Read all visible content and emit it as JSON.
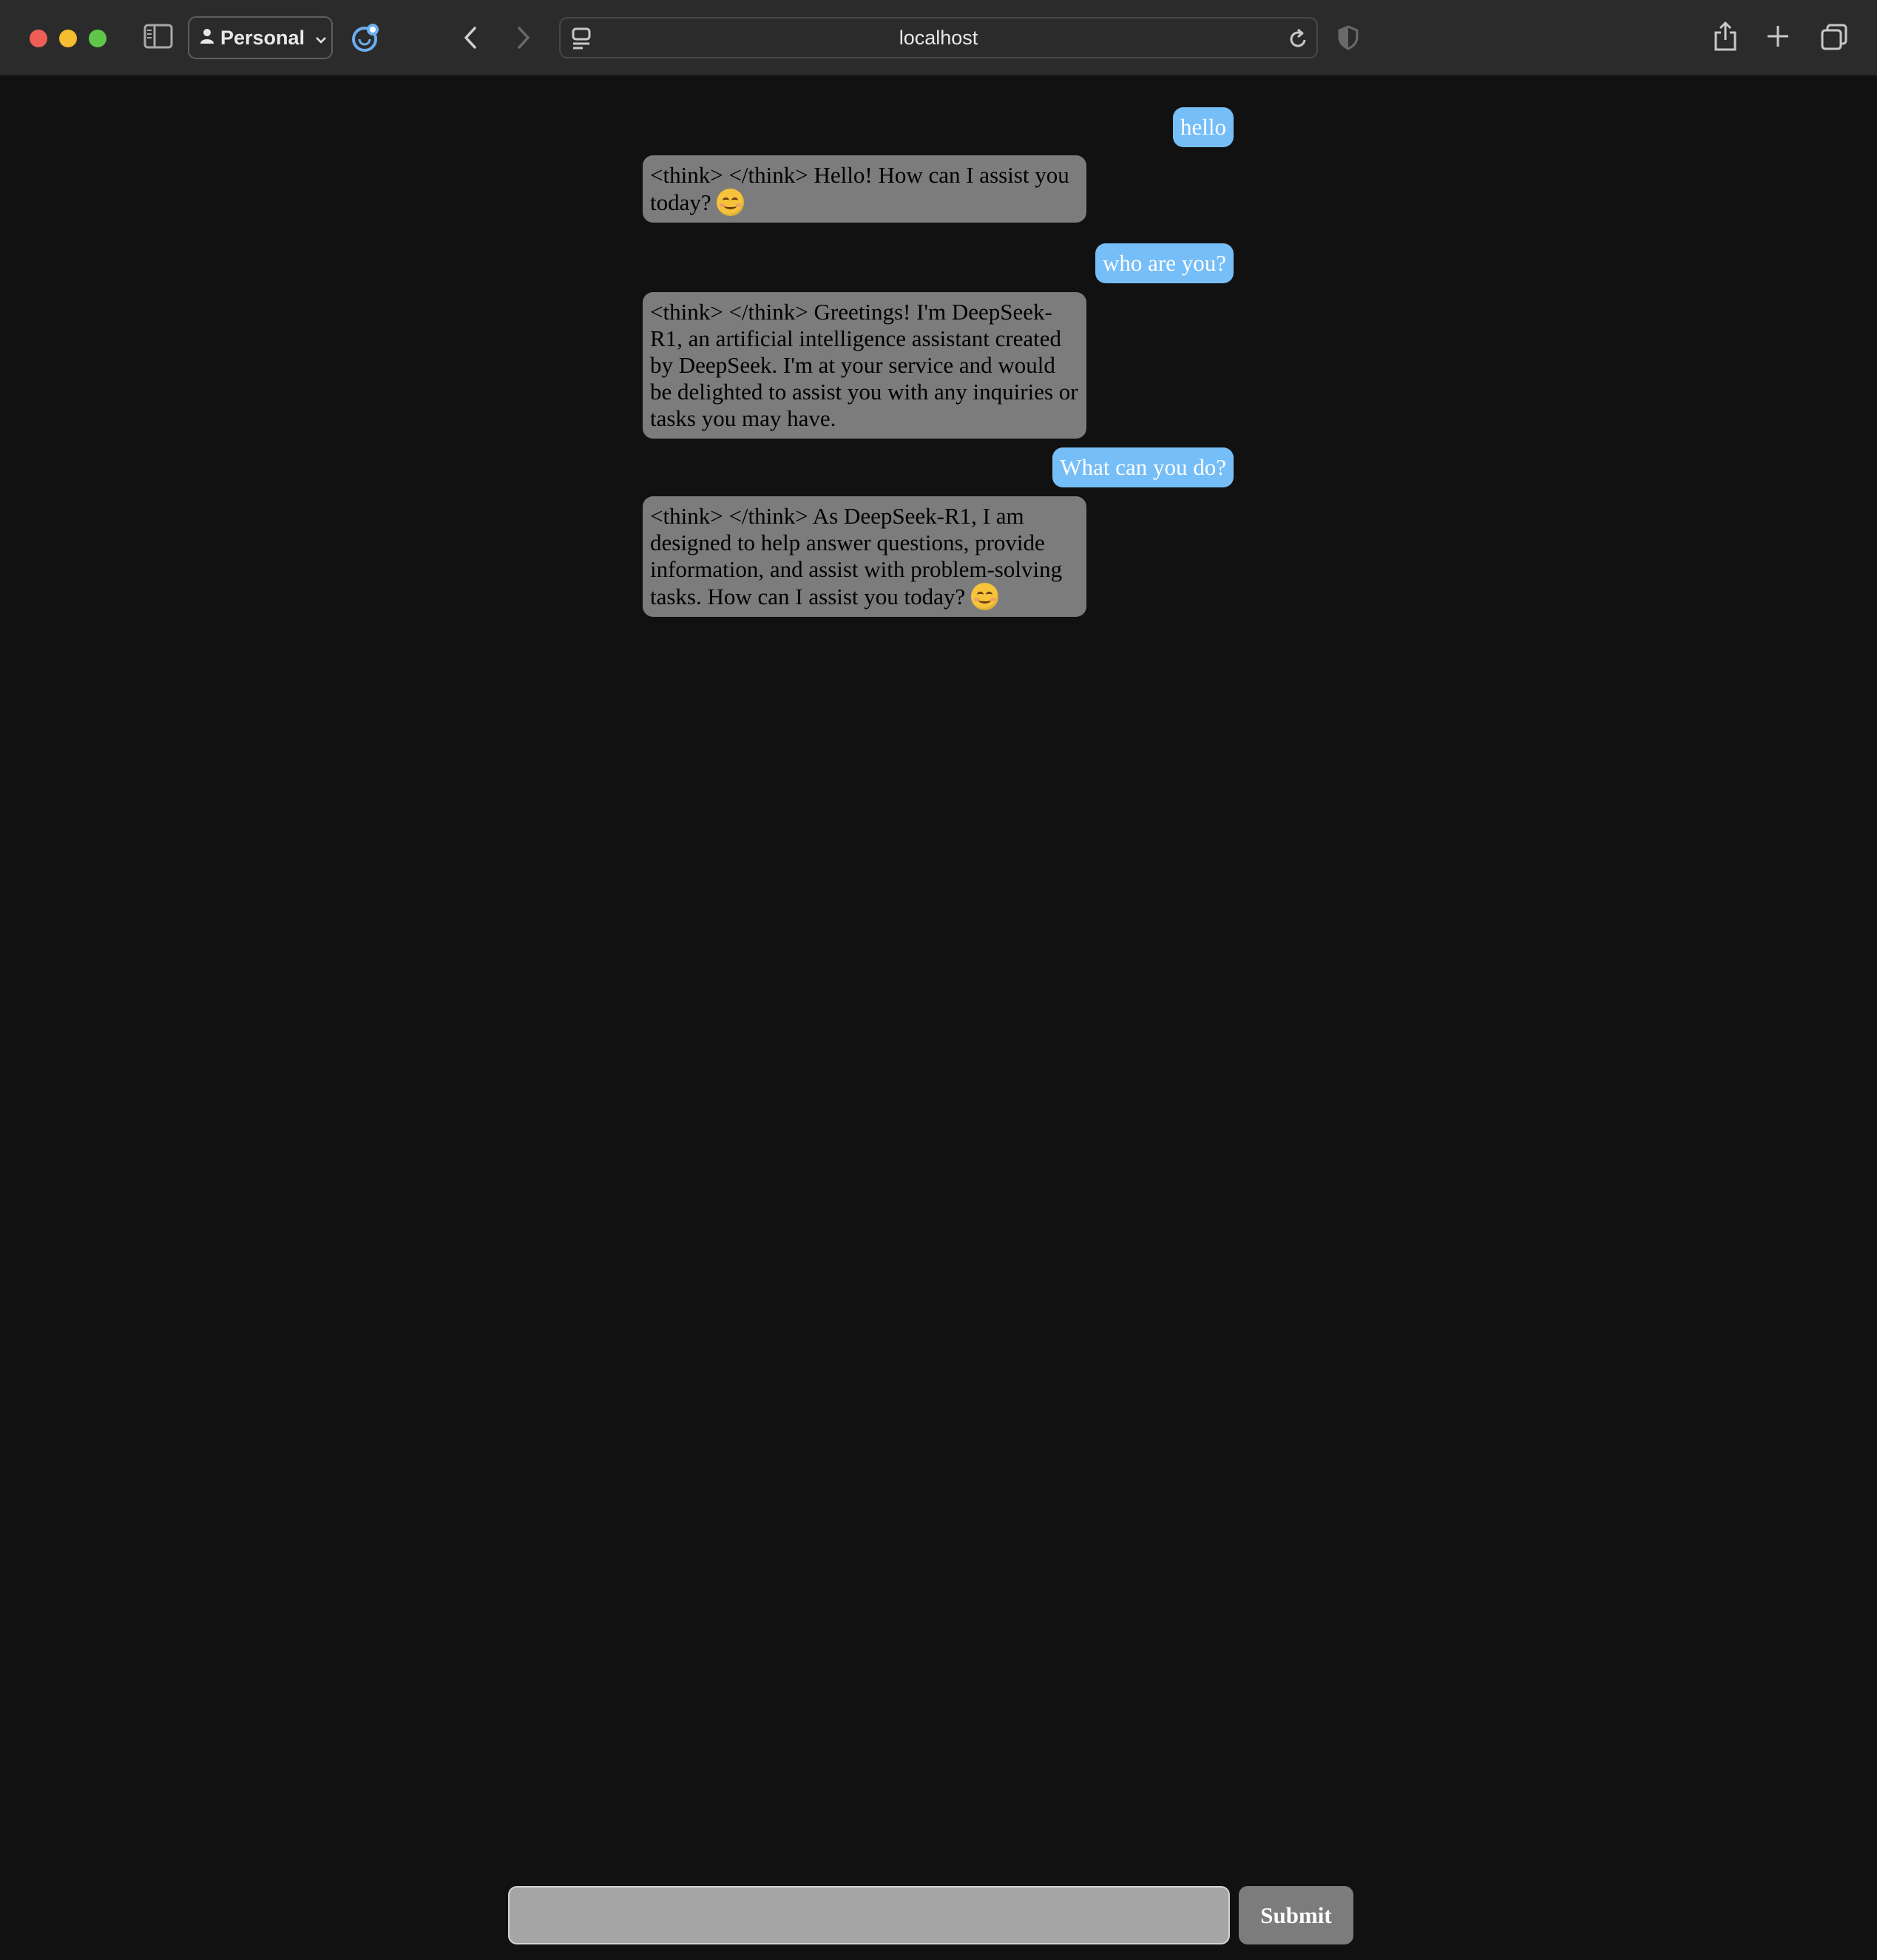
{
  "browser": {
    "profile_label": "Personal",
    "url": "localhost",
    "icons": [
      "sidebar-icon",
      "person-icon",
      "chevron-down-icon",
      "extension-icon",
      "back-icon",
      "forward-icon",
      "page-menu-icon",
      "reload-icon",
      "shield-icon",
      "share-icon",
      "new-tab-icon",
      "tabs-overview-icon"
    ]
  },
  "colors": {
    "background": "#111111",
    "user_bubble": "#76bef7",
    "bot_bubble": "#7c7c7c",
    "input": "#a5a5a5",
    "submit": "#7c7c7c"
  },
  "messages": [
    {
      "role": "user",
      "text": "hello"
    },
    {
      "role": "assistant",
      "text": "<think> </think> Hello! How can I assist you today?",
      "emoji": "smiling-face"
    },
    {
      "role": "user",
      "text": "who are you?"
    },
    {
      "role": "assistant",
      "text": "<think> </think> Greetings! I'm DeepSeek-R1, an artificial intelligence assistant created by DeepSeek. I'm at your service and would be delighted to assist you with any inquiries or tasks you may have."
    },
    {
      "role": "user",
      "text": "What can you do?"
    },
    {
      "role": "assistant",
      "text": "<think> </think> As DeepSeek-R1, I am designed to help answer questions, provide information, and assist with problem-solving tasks. How can I assist you today?",
      "emoji": "smiling-face"
    }
  ],
  "composer": {
    "value": "",
    "submit_label": "Submit"
  }
}
